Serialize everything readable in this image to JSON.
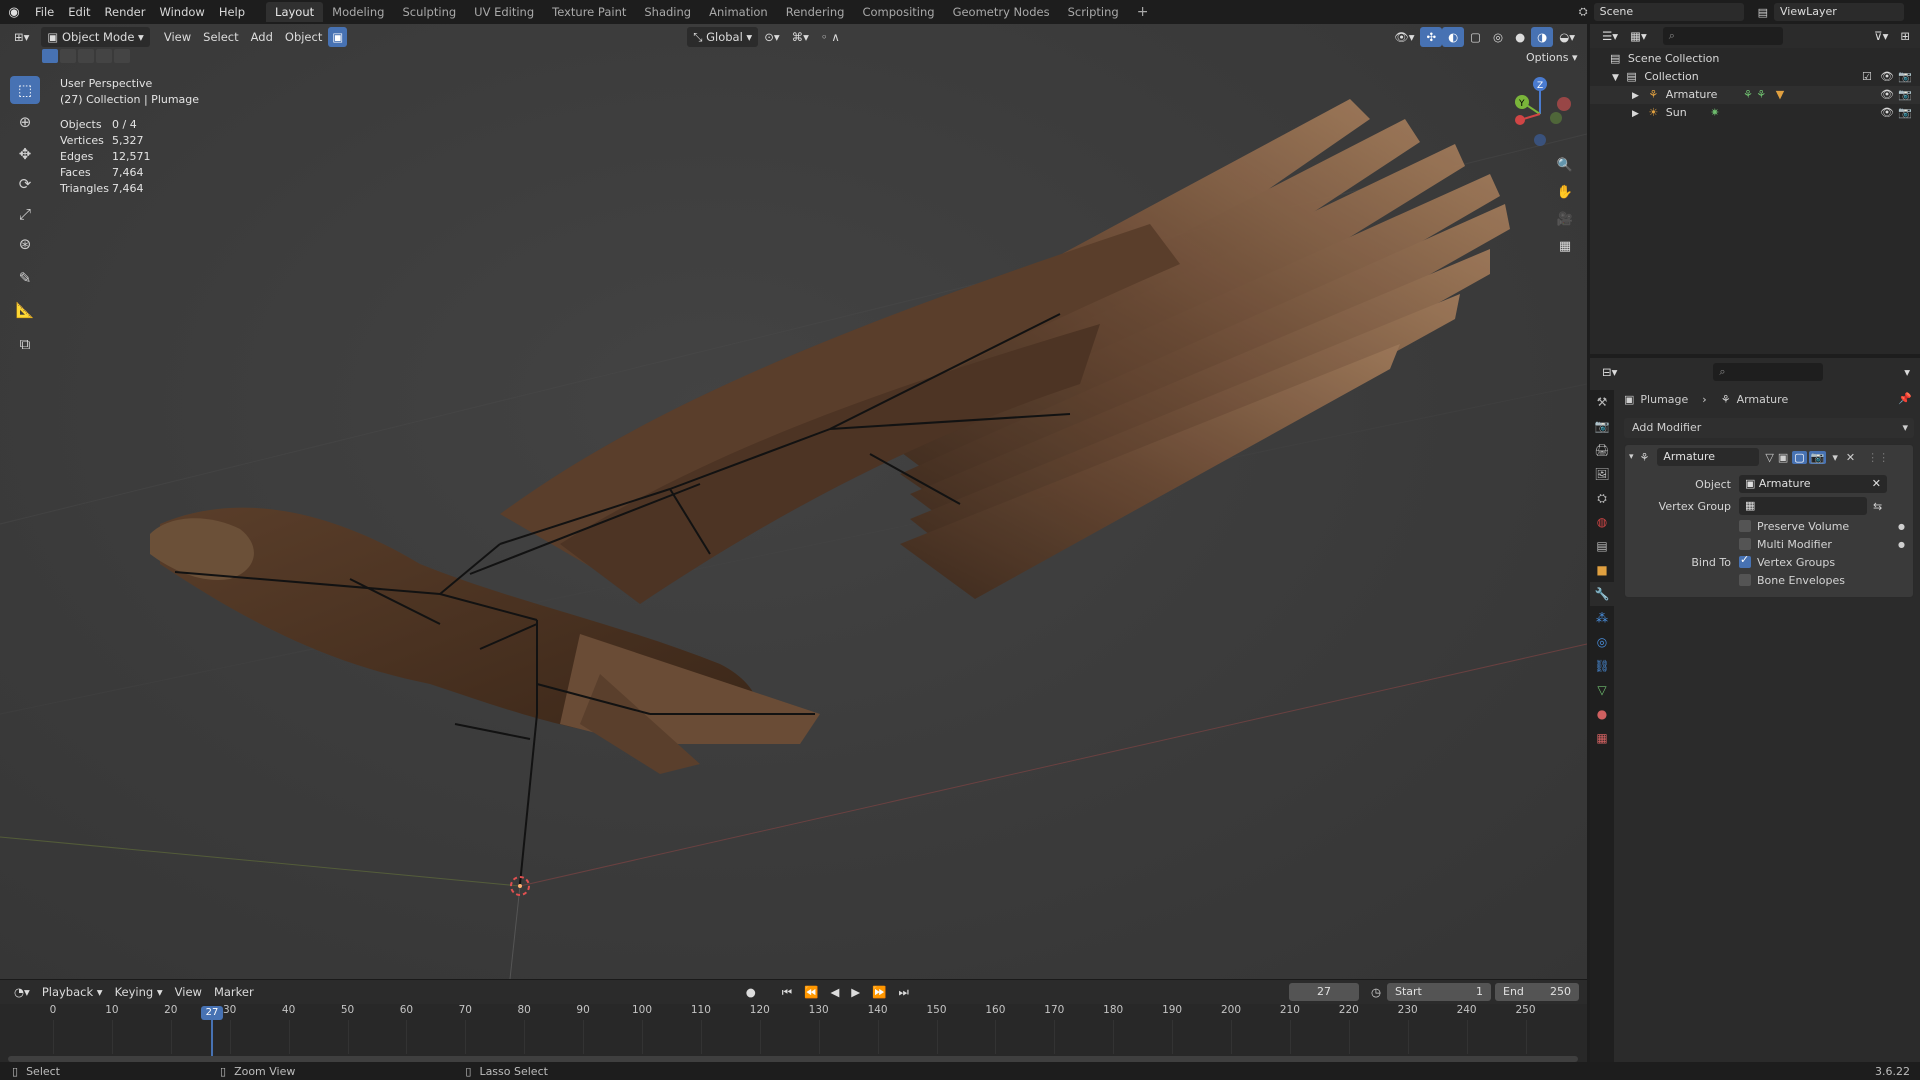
{
  "topbar": {
    "menus": [
      "File",
      "Edit",
      "Render",
      "Window",
      "Help"
    ],
    "workspaces": [
      "Layout",
      "Modeling",
      "Sculpting",
      "UV Editing",
      "Texture Paint",
      "Shading",
      "Animation",
      "Rendering",
      "Compositing",
      "Geometry Nodes",
      "Scripting"
    ],
    "active_workspace": "Layout",
    "scene": "Scene",
    "view_layer": "ViewLayer"
  },
  "viewport": {
    "mode": "Object Mode",
    "menus": [
      "View",
      "Select",
      "Add",
      "Object"
    ],
    "transform_orientation": "Global",
    "options_label": "Options",
    "perspective": "User Perspective",
    "collection_info": "(27) Collection | Plumage",
    "stats": [
      {
        "key": "Objects",
        "value": "0 / 4"
      },
      {
        "key": "Vertices",
        "value": "5,327"
      },
      {
        "key": "Edges",
        "value": "12,571"
      },
      {
        "key": "Faces",
        "value": "7,464"
      },
      {
        "key": "Triangles",
        "value": "7,464"
      }
    ],
    "tools": [
      "select-box-icon",
      "cursor-icon",
      "move-icon",
      "rotate-icon",
      "scale-icon",
      "transform-icon",
      "annotate-icon",
      "measure-icon",
      "add-cube-icon"
    ]
  },
  "timeline": {
    "menus": [
      "Playback",
      "Keying",
      "View",
      "Marker"
    ],
    "current_frame": "27",
    "start_label": "Start",
    "start_value": "1",
    "end_label": "End",
    "end_value": "250",
    "ticks": [
      "0",
      "10",
      "20",
      "30",
      "40",
      "50",
      "60",
      "70",
      "80",
      "90",
      "100",
      "110",
      "120",
      "130",
      "140",
      "150",
      "160",
      "170",
      "180",
      "190",
      "200",
      "210",
      "220",
      "230",
      "240",
      "250"
    ]
  },
  "outliner": {
    "root": "Scene Collection",
    "collection": "Collection",
    "items": [
      {
        "name": "Armature"
      },
      {
        "name": "Sun"
      }
    ]
  },
  "properties": {
    "breadcrumb_object": "Plumage",
    "breadcrumb_modifier": "Armature",
    "add_modifier": "Add Modifier",
    "modifier_name": "Armature",
    "object_label": "Object",
    "object_value": "Armature",
    "vertex_group_label": "Vertex Group",
    "preserve_volume": "Preserve Volume",
    "multi_modifier": "Multi Modifier",
    "bind_to_label": "Bind To",
    "vertex_groups": "Vertex Groups",
    "bone_envelopes": "Bone Envelopes",
    "vertex_groups_checked": true
  },
  "statusbar": {
    "select": "Select",
    "zoom_view": "Zoom View",
    "lasso_select": "Lasso Select",
    "version": "3.6.22"
  }
}
